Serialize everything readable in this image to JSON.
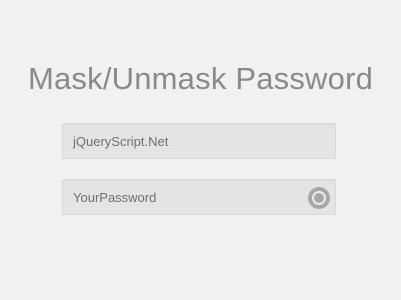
{
  "page": {
    "title": "Mask/Unmask Password"
  },
  "form": {
    "username": {
      "value": "jQueryScript.Net",
      "placeholder": ""
    },
    "password": {
      "value": "YourPassword",
      "placeholder": "",
      "toggle_icon": "eye-toggle-icon"
    }
  },
  "colors": {
    "background": "#f1f1f1",
    "title_text": "#8a8a8a",
    "field_background": "#e4e4e4",
    "toggle": "#a7a7a7"
  }
}
